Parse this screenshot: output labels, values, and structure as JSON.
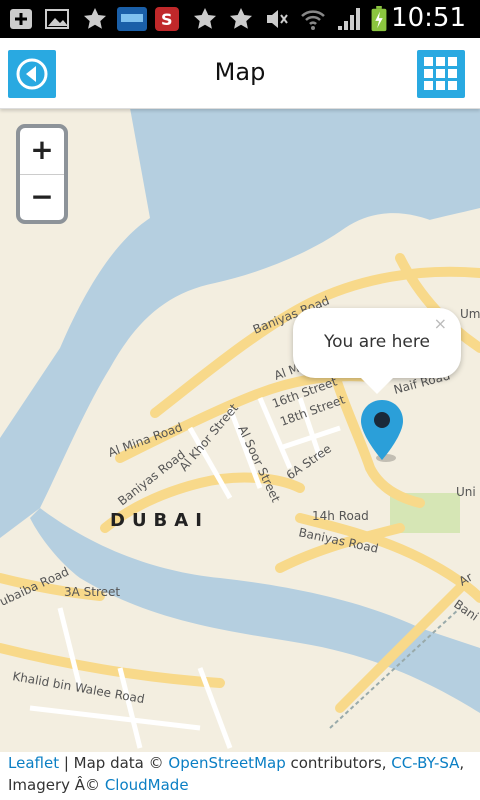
{
  "status_bar": {
    "time": "10:51",
    "icons": [
      "add-icon",
      "gallery-icon",
      "star-icon",
      "weather-widget-icon",
      "app-s-icon",
      "star-icon",
      "star-icon",
      "mute-icon",
      "wifi-icon",
      "signal-icon",
      "battery-charging-icon"
    ]
  },
  "header": {
    "title": "Map",
    "back_icon": "back-arrow-icon",
    "grid_icon": "grid-menu-icon",
    "accent": "#29a9e1"
  },
  "map": {
    "zoom_in": "+",
    "zoom_out": "−",
    "popup_text": "You are here",
    "popup_close": "×",
    "marker_icon": "location-pin-icon",
    "city_label": "DUBAI",
    "street_labels": {
      "baniyas_top": "Baniyas Road",
      "al_mina": "Al Mina Road",
      "baniyas_left": "Baniyas Road",
      "al_khor": "Al Khor Street",
      "al_soor": "Al Soor Street",
      "sixteenth": "16th Street",
      "eighteenth": "18th Street",
      "sixa": "6A Stree",
      "fourteenth": "14h Road",
      "baniyas_bottom": "Baniyas Road",
      "naif": "Naif Road",
      "al_m": "Al M",
      "um": "Um",
      "uni": "Uni",
      "ar": "Ar",
      "bani_right": "Bani",
      "khalid": "Khalid bin Walee Road",
      "kubaiba": "ubaiba Road",
      "three_a": "3A Street"
    },
    "colors": {
      "water": "#b5cfe0",
      "land": "#f3eee0",
      "road": "#f8d98a",
      "marker": "#2b9fd9"
    }
  },
  "attribution": {
    "leaflet": "Leaflet",
    "sep": " | Map data © ",
    "osm": "OpenStreetMap",
    "contributors": " contributors, ",
    "license": "CC-BY-SA",
    "comma": ",",
    "imagery": "Imagery Â© ",
    "cloudmade": "CloudMade"
  }
}
